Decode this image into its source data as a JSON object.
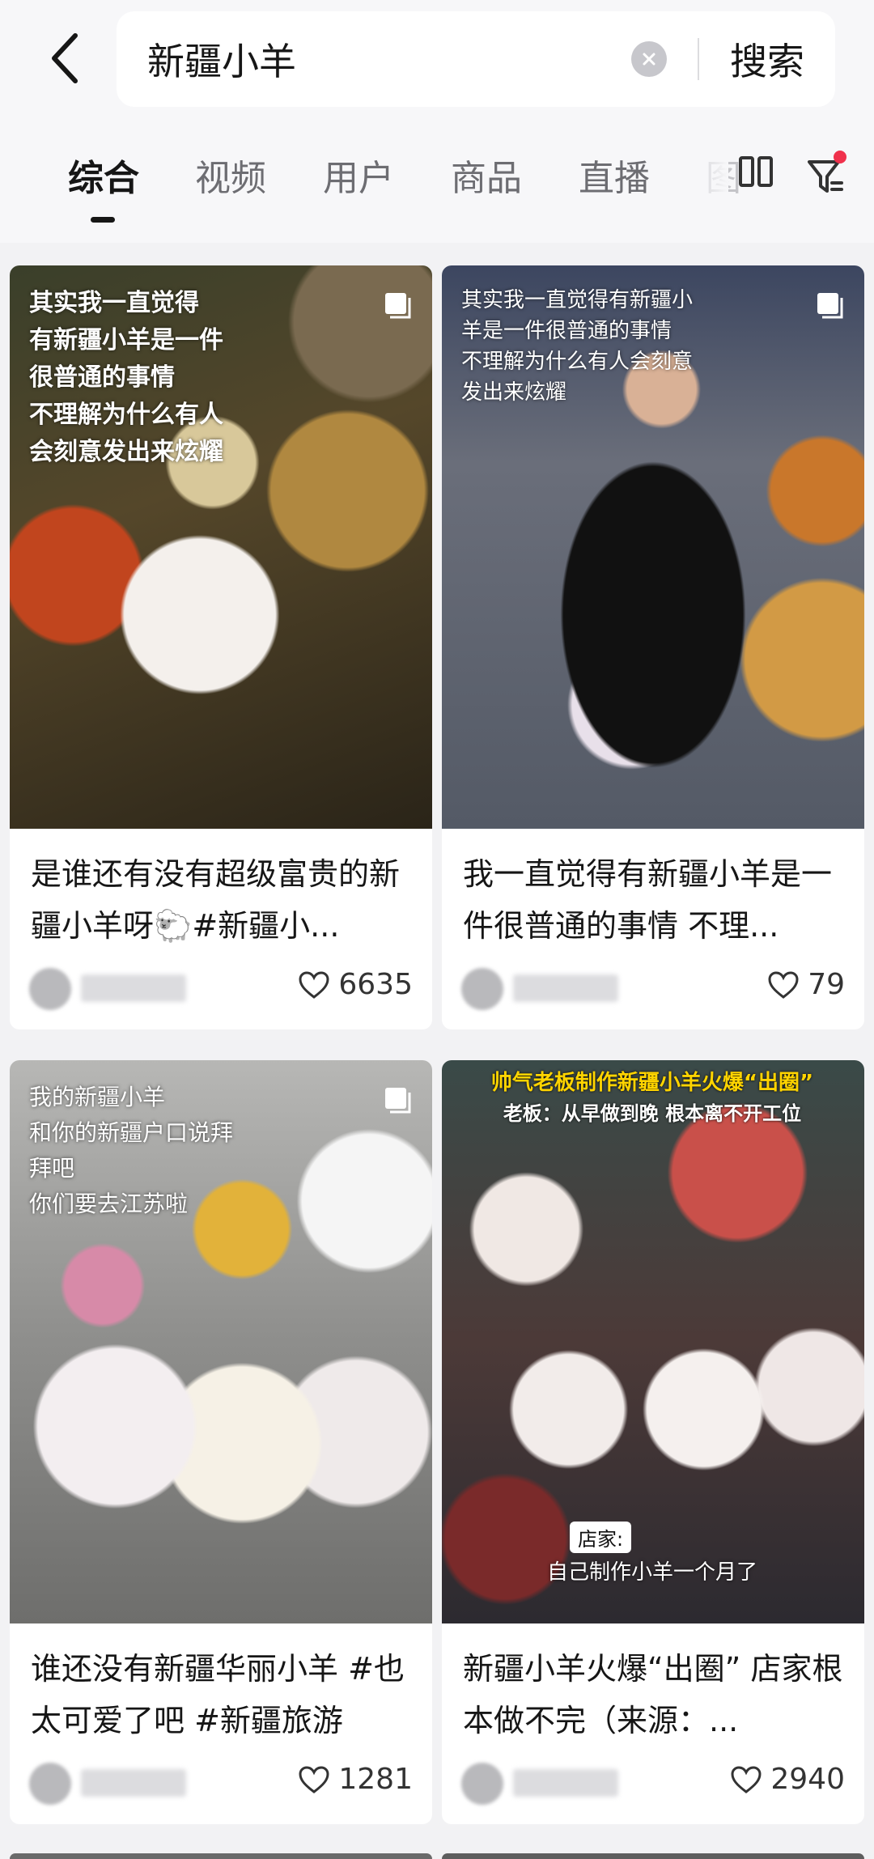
{
  "search": {
    "query": "新疆小羊",
    "button_label": "搜索"
  },
  "tabs": [
    {
      "label": "综合",
      "active": true
    },
    {
      "label": "视频"
    },
    {
      "label": "用户"
    },
    {
      "label": "商品"
    },
    {
      "label": "直播"
    },
    {
      "label": "图"
    }
  ],
  "icons": {
    "back": "chevron-left-icon",
    "clear": "clear-icon",
    "layout": "double-column-icon",
    "filter": "filter-icon",
    "multi": "multi-image-icon",
    "like": "heart-icon"
  },
  "colors": {
    "accent_dot": "#f0314c",
    "background": "#f2f2f4"
  },
  "cards": [
    {
      "overlay_text": "其实我一直觉得\n有新疆小羊是一件\n很普通的事情\n不理解为什么有人\n会刻意发出来炫耀",
      "title": "是谁还有没有超级富贵的新疆小羊呀🐑#新疆小...",
      "likes": "6635"
    },
    {
      "overlay_text": "其实我一直觉得有新疆小\n羊是一件很普通的事情\n不理解为什么有人会刻意\n发出来炫耀",
      "title": "我一直觉得有新疆小羊是一件很普通的事情 不理...",
      "likes": "79"
    },
    {
      "overlay_text": "我的新疆小羊\n和你的新疆户口说拜\n拜吧\n你们要去江苏啦",
      "title": "谁还没有新疆华丽小羊 #也太可爱了吧 #新疆旅游",
      "likes": "1281"
    },
    {
      "banner": "帅气老板制作新疆小羊火爆“出圈”",
      "banner_sub": "老板：从早做到晚 根本离不开工位",
      "caption_tag": "店家:",
      "caption": "自己制作小羊一个月了",
      "title": "新疆小羊火爆“出圈” 店家根本做不完（来源：...",
      "likes": "2940"
    }
  ]
}
